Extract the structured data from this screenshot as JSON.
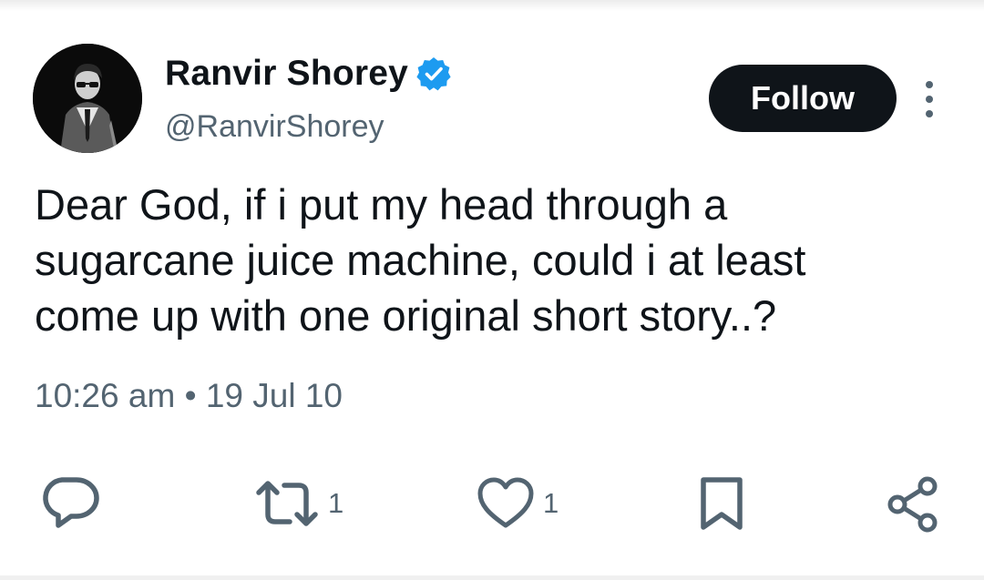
{
  "tweet": {
    "author": {
      "display_name": "Ranvir Shorey",
      "handle": "@RanvirShorey",
      "verified_icon": "verified-badge-icon",
      "avatar": "profile-photo"
    },
    "follow_label": "Follow",
    "more_icon": "more-options-icon",
    "text": "Dear God, if i put my head through a\nsugarcane juice machine, could i at least\ncome up with one original short story..?",
    "time": "10:26 am",
    "separator": "•",
    "date": "19 Jul 10",
    "actions": {
      "reply": {
        "icon": "reply-icon"
      },
      "retweet": {
        "icon": "retweet-icon",
        "count": "1"
      },
      "like": {
        "icon": "heart-icon",
        "count": "1"
      },
      "bookmark": {
        "icon": "bookmark-icon"
      },
      "share": {
        "icon": "share-icon"
      }
    }
  },
  "colors": {
    "text_primary": "#0f1419",
    "text_secondary": "#536471",
    "verified_blue": "#1d9bf0",
    "follow_bg": "#0f1419",
    "follow_text": "#ffffff",
    "icon_gray": "#536471"
  }
}
